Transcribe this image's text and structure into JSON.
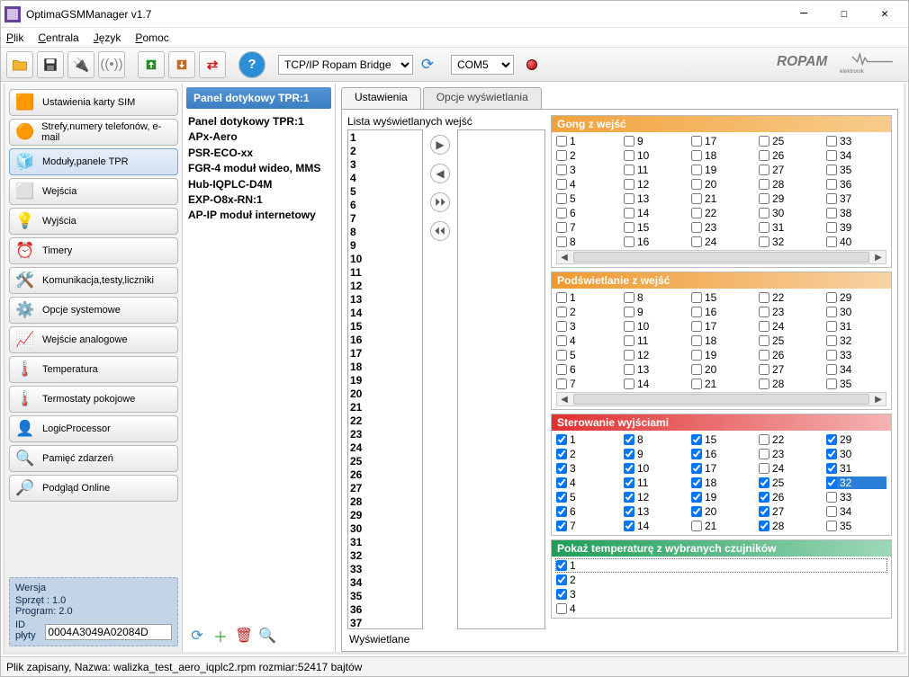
{
  "window": {
    "title": "OptimaGSMManager v1.7"
  },
  "menu": {
    "items": [
      "Plik",
      "Centrala",
      "Język",
      "Pomoc"
    ]
  },
  "toolbar": {
    "conn_select": "TCP/IP Ropam Bridge",
    "com_select": "COM5"
  },
  "sidebar": {
    "items": [
      {
        "label": "Ustawienia karty SIM",
        "icon": "🟧"
      },
      {
        "label": "Strefy,numery telefonów, e-mail",
        "icon": "🟠",
        "twoline": true
      },
      {
        "label": "Moduły,panele TPR",
        "icon": "🧊",
        "active": true
      },
      {
        "label": "Wejścia",
        "icon": "⬜"
      },
      {
        "label": "Wyjścia",
        "icon": "💡"
      },
      {
        "label": "Timery",
        "icon": "⏰"
      },
      {
        "label": "Komunikacja,testy,liczniki",
        "icon": "🛠️"
      },
      {
        "label": "Opcje systemowe",
        "icon": "⚙️"
      },
      {
        "label": "Wejście analogowe",
        "icon": "📈"
      },
      {
        "label": "Temperatura",
        "icon": "🌡️"
      },
      {
        "label": "Termostaty pokojowe",
        "icon": "🌡️"
      },
      {
        "label": "LogicProcessor",
        "icon": "👤"
      },
      {
        "label": "Pamięć zdarzeń",
        "icon": "🔍"
      },
      {
        "label": "Podgląd Online",
        "icon": "🔎"
      }
    ]
  },
  "version": {
    "title": "Wersja",
    "hw": "Sprzęt : 1.0",
    "sw": "Program: 2.0",
    "id_label": "ID płyty",
    "id_value": "0004A3049A02084D"
  },
  "tree": {
    "header": "Panel dotykowy TPR:1",
    "items": [
      "Panel dotykowy TPR:1",
      "APx-Aero",
      "PSR-ECO-xx",
      "FGR-4 moduł wideo, MMS",
      "Hub-IQPLC-D4M",
      "EXP-O8x-RN:1",
      "AP-IP moduł internetowy"
    ]
  },
  "tabs": {
    "active": "Ustawienia",
    "inactive": "Opcje wyświetlania"
  },
  "list": {
    "label": "Lista wyświetlanych wejść",
    "count": 40,
    "bottom": "Wyświetlane"
  },
  "groups": {
    "gong": {
      "title": "Gong z wejść",
      "rows": 8,
      "cols": 5,
      "start": 1,
      "checked": []
    },
    "pods": {
      "title": "Podświetlanie z wejść",
      "rows": 7,
      "cols": 5,
      "start": 1,
      "checked": []
    },
    "ster": {
      "title": "Sterowanie wyjściami",
      "rows": 7,
      "cols": 5,
      "start": 1,
      "checked": [
        1,
        2,
        3,
        4,
        5,
        6,
        7,
        8,
        9,
        10,
        11,
        12,
        13,
        14,
        15,
        16,
        17,
        18,
        19,
        20,
        25,
        26,
        27,
        28,
        29,
        30,
        31,
        32
      ],
      "highlight": [
        32
      ]
    },
    "temp": {
      "title": "Pokaż temperaturę z wybranych czujników",
      "rows": 4,
      "cols": 1,
      "start": 1,
      "checked": [
        1,
        2,
        3
      ],
      "focus": [
        1
      ]
    }
  },
  "status": "Plik zapisany, Nazwa: walizka_test_aero_iqplc2.rpm rozmiar:52417 bajtów"
}
